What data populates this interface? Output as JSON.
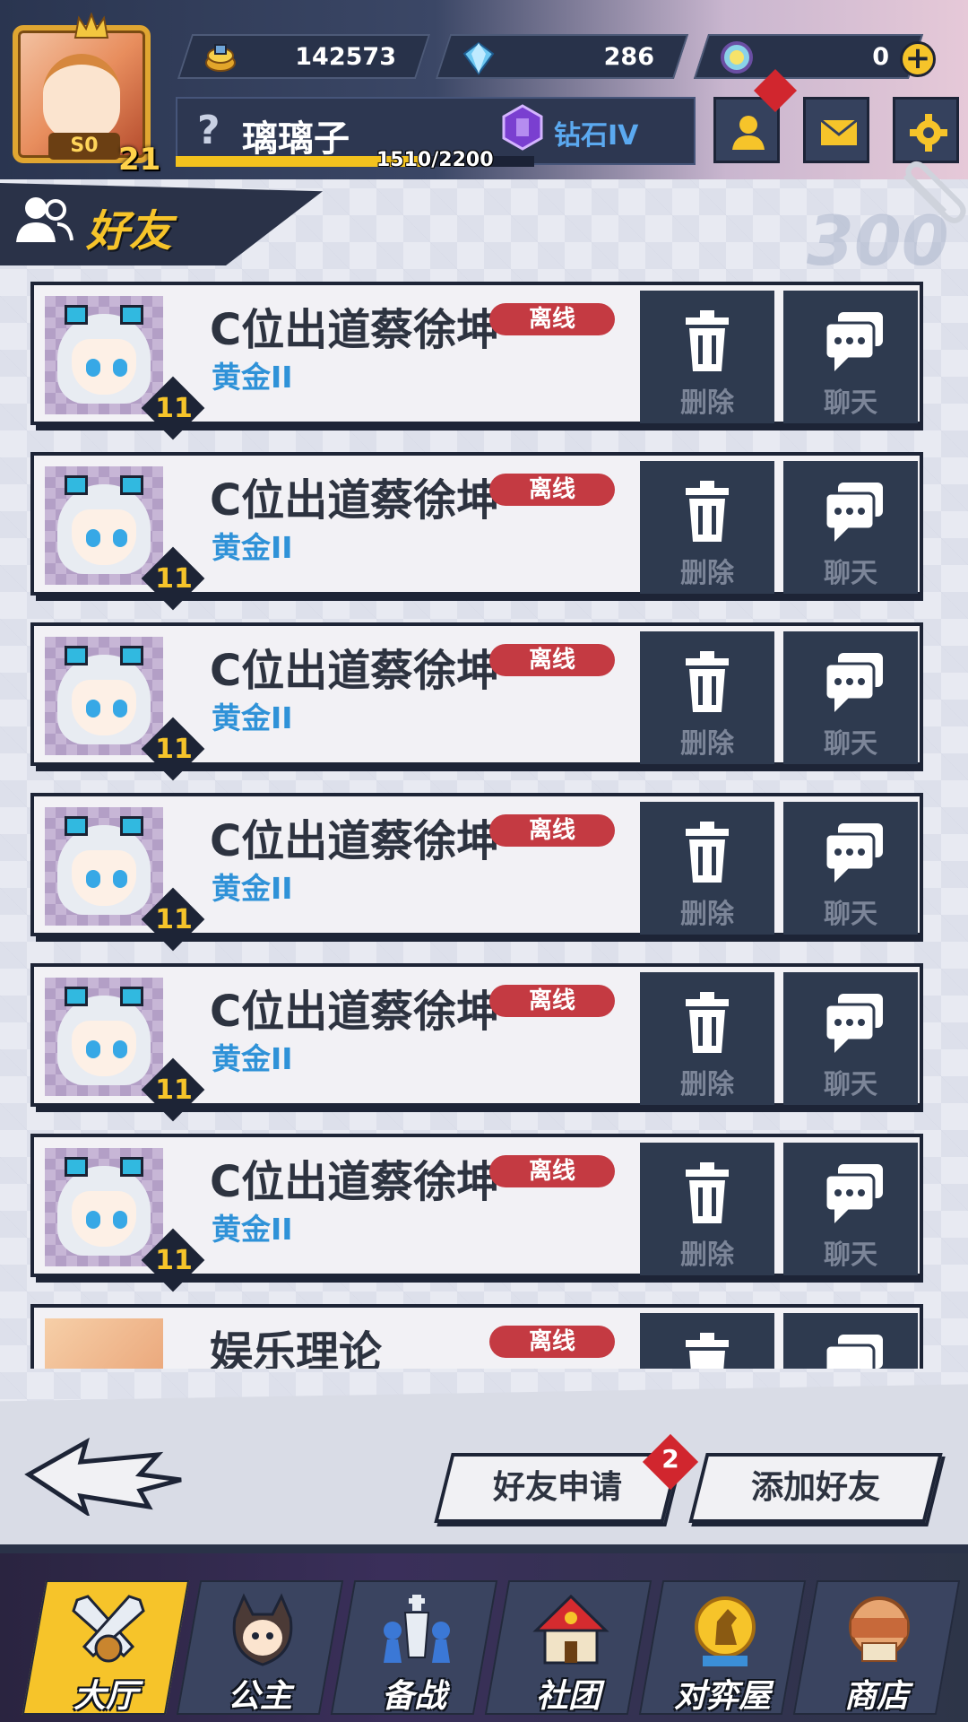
{
  "header": {
    "avatar": {
      "rank_tag": "S0",
      "level": "21"
    },
    "currencies": [
      {
        "icon": "gold-coin-icon",
        "value": "142573"
      },
      {
        "icon": "diamond-icon",
        "value": "286"
      },
      {
        "icon": "rainbow-token-icon",
        "value": "0"
      }
    ],
    "plus_label": "+",
    "player": {
      "question_mark": "?",
      "name": "璃璃子",
      "rank": "钻石IV",
      "exp_text": "1510/2200",
      "exp_fraction": 0.686
    }
  },
  "section": {
    "title": "好友",
    "count_watermark": "300"
  },
  "friends": [
    {
      "name": "C位出道蔡徐坤",
      "rank": "黄金II",
      "level": "11",
      "status": "离线",
      "delete_label": "删除",
      "chat_label": "聊天"
    },
    {
      "name": "C位出道蔡徐坤",
      "rank": "黄金II",
      "level": "11",
      "status": "离线",
      "delete_label": "删除",
      "chat_label": "聊天"
    },
    {
      "name": "C位出道蔡徐坤",
      "rank": "黄金II",
      "level": "11",
      "status": "离线",
      "delete_label": "删除",
      "chat_label": "聊天"
    },
    {
      "name": "C位出道蔡徐坤",
      "rank": "黄金II",
      "level": "11",
      "status": "离线",
      "delete_label": "删除",
      "chat_label": "聊天"
    },
    {
      "name": "C位出道蔡徐坤",
      "rank": "黄金II",
      "level": "11",
      "status": "离线",
      "delete_label": "删除",
      "chat_label": "聊天"
    },
    {
      "name": "C位出道蔡徐坤",
      "rank": "黄金II",
      "level": "11",
      "status": "离线",
      "delete_label": "删除",
      "chat_label": "聊天"
    },
    {
      "name": "娱乐理论",
      "rank": "",
      "level": "",
      "status": "离线",
      "delete_label": "",
      "chat_label": ""
    }
  ],
  "actions": {
    "friend_requests_label": "好友申请",
    "friend_requests_count": "2",
    "add_friend_label": "添加好友"
  },
  "nav": [
    {
      "label": "大厅",
      "icon": "crossed-swords-icon",
      "active": true
    },
    {
      "label": "公主",
      "icon": "princess-icon",
      "active": false
    },
    {
      "label": "备战",
      "icon": "chess-pieces-icon",
      "active": false
    },
    {
      "label": "社团",
      "icon": "guild-house-icon",
      "active": false
    },
    {
      "label": "对弈屋",
      "icon": "golden-knight-icon",
      "active": false
    },
    {
      "label": "商店",
      "icon": "shop-icon",
      "active": false
    }
  ],
  "colors": {
    "accent_yellow": "#f6c42a",
    "offline_red": "#c43a42",
    "rank_blue": "#2f92d8",
    "dark_navy": "#1d2436"
  }
}
